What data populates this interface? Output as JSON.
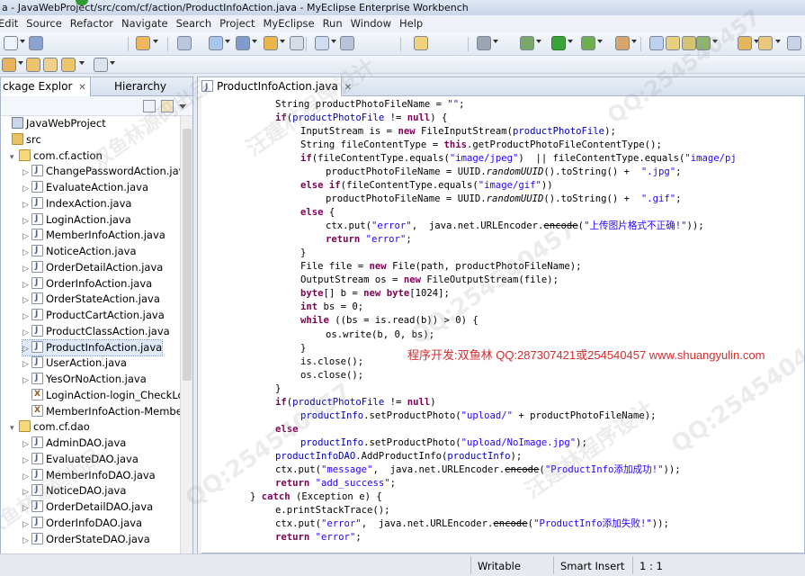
{
  "window": {
    "title": "a - JavaWebProject/src/com/cf/action/ProductInfoAction.java - MyEclipse Enterprise Workbench"
  },
  "menu": [
    "Edit",
    "Source",
    "Refactor",
    "Navigate",
    "Search",
    "Project",
    "MyEclipse",
    "Run",
    "Window",
    "Help"
  ],
  "left_panel": {
    "tabs": [
      {
        "label": "ckage Explor",
        "close": "✕"
      },
      {
        "label": "Hierarchy"
      }
    ],
    "tree": [
      {
        "label": "JavaWebProject",
        "type": "project",
        "level": 0,
        "toggle": "",
        "selected": false
      },
      {
        "label": "src",
        "type": "src",
        "level": 0,
        "toggle": "",
        "selected": false
      },
      {
        "label": "com.cf.action",
        "type": "package",
        "level": 1,
        "toggle": "▾",
        "selected": false
      },
      {
        "label": "ChangePasswordAction.java",
        "type": "java",
        "level": 2,
        "toggle": "▷",
        "selected": false
      },
      {
        "label": "EvaluateAction.java",
        "type": "java",
        "level": 2,
        "toggle": "▷",
        "selected": false
      },
      {
        "label": "IndexAction.java",
        "type": "java",
        "level": 2,
        "toggle": "▷",
        "selected": false
      },
      {
        "label": "LoginAction.java",
        "type": "java",
        "level": 2,
        "toggle": "▷",
        "selected": false
      },
      {
        "label": "MemberInfoAction.java",
        "type": "java",
        "level": 2,
        "toggle": "▷",
        "selected": false
      },
      {
        "label": "NoticeAction.java",
        "type": "java",
        "level": 2,
        "toggle": "▷",
        "selected": false
      },
      {
        "label": "OrderDetailAction.java",
        "type": "java",
        "level": 2,
        "toggle": "▷",
        "selected": false
      },
      {
        "label": "OrderInfoAction.java",
        "type": "java",
        "level": 2,
        "toggle": "▷",
        "selected": false
      },
      {
        "label": "OrderStateAction.java",
        "type": "java",
        "level": 2,
        "toggle": "▷",
        "selected": false
      },
      {
        "label": "ProductCartAction.java",
        "type": "java",
        "level": 2,
        "toggle": "▷",
        "selected": false
      },
      {
        "label": "ProductClassAction.java",
        "type": "java",
        "level": 2,
        "toggle": "▷",
        "selected": false
      },
      {
        "label": "ProductInfoAction.java",
        "type": "java",
        "level": 2,
        "toggle": "▷",
        "selected": true
      },
      {
        "label": "UserAction.java",
        "type": "java",
        "level": 2,
        "toggle": "▷",
        "selected": false
      },
      {
        "label": "YesOrNoAction.java",
        "type": "java",
        "level": 2,
        "toggle": "▷",
        "selected": false
      },
      {
        "label": "LoginAction-login_CheckLog",
        "type": "xml",
        "level": 2,
        "toggle": "",
        "selected": false
      },
      {
        "label": "MemberInfoAction-Member",
        "type": "xml",
        "level": 2,
        "toggle": "",
        "selected": false
      },
      {
        "label": "com.cf.dao",
        "type": "package",
        "level": 1,
        "toggle": "▾",
        "selected": false
      },
      {
        "label": "AdminDAO.java",
        "type": "java",
        "level": 2,
        "toggle": "▷",
        "selected": false
      },
      {
        "label": "EvaluateDAO.java",
        "type": "java",
        "level": 2,
        "toggle": "▷",
        "selected": false
      },
      {
        "label": "MemberInfoDAO.java",
        "type": "java",
        "level": 2,
        "toggle": "▷",
        "selected": false
      },
      {
        "label": "NoticeDAO.java",
        "type": "java",
        "level": 2,
        "toggle": "▷",
        "selected": false
      },
      {
        "label": "OrderDetailDAO.java",
        "type": "java",
        "level": 2,
        "toggle": "▷",
        "selected": false
      },
      {
        "label": "OrderInfoDAO.java",
        "type": "java",
        "level": 2,
        "toggle": "▷",
        "selected": false
      },
      {
        "label": "OrderStateDAO.java",
        "type": "java",
        "level": 2,
        "toggle": "▷",
        "selected": false
      }
    ]
  },
  "editor": {
    "tab_label": "ProductInfoAction.java",
    "tab_close": "✕",
    "lines": [
      {
        "indent": 3,
        "tokens": [
          [
            "",
            "String productPhotoFileName = "
          ],
          [
            "str",
            "\"\""
          ],
          [
            "",
            ";"
          ]
        ]
      },
      {
        "indent": 3,
        "tokens": [
          [
            "kw",
            "if"
          ],
          [
            "",
            "("
          ],
          [
            "fld",
            "productPhotoFile"
          ],
          [
            "",
            " != "
          ],
          [
            "kw",
            "null"
          ],
          [
            "",
            ") {"
          ]
        ]
      },
      {
        "indent": 4,
        "tokens": [
          [
            "",
            "InputStream is = "
          ],
          [
            "kw",
            "new"
          ],
          [
            "",
            " FileInputStream("
          ],
          [
            "fld",
            "productPhotoFile"
          ],
          [
            "",
            ");"
          ]
        ]
      },
      {
        "indent": 4,
        "tokens": [
          [
            "",
            "String fileContentType = "
          ],
          [
            "kw",
            "this"
          ],
          [
            "",
            ".getProductPhotoFileContentType();"
          ]
        ]
      },
      {
        "indent": 4,
        "tokens": [
          [
            "kw",
            "if"
          ],
          [
            "",
            "(fileContentType.equals("
          ],
          [
            "str",
            "\"image/jpeg\""
          ],
          [
            "",
            ")  || fileContentType.equals("
          ],
          [
            "str",
            "\"image/pj"
          ]
        ]
      },
      {
        "indent": 5,
        "tokens": [
          [
            "",
            "productPhotoFileName = UUID."
          ],
          [
            "ital",
            "randomUUID"
          ],
          [
            "",
            "().toString() +  "
          ],
          [
            "str",
            "\".jpg\""
          ],
          [
            "",
            ";"
          ]
        ]
      },
      {
        "indent": 4,
        "tokens": [
          [
            "kw",
            "else if"
          ],
          [
            "",
            "(fileContentType.equals("
          ],
          [
            "str",
            "\"image/gif\""
          ],
          [
            "",
            "))"
          ]
        ]
      },
      {
        "indent": 5,
        "tokens": [
          [
            "",
            "productPhotoFileName = UUID."
          ],
          [
            "ital",
            "randomUUID"
          ],
          [
            "",
            "().toString() +  "
          ],
          [
            "str",
            "\".gif\""
          ],
          [
            "",
            ";"
          ]
        ]
      },
      {
        "indent": 4,
        "tokens": [
          [
            "kw",
            "else"
          ],
          [
            "",
            " {"
          ]
        ]
      },
      {
        "indent": 5,
        "tokens": [
          [
            "",
            "ctx.put("
          ],
          [
            "str",
            "\"error\""
          ],
          [
            "",
            ",  java.net.URLEncoder."
          ],
          [
            "strike",
            "encode"
          ],
          [
            "",
            "("
          ],
          [
            "str",
            "\"上传图片格式不正确!\""
          ],
          [
            "",
            "));"
          ]
        ]
      },
      {
        "indent": 5,
        "tokens": [
          [
            "kw",
            "return"
          ],
          [
            "",
            " "
          ],
          [
            "str",
            "\"error\""
          ],
          [
            "",
            ";"
          ]
        ]
      },
      {
        "indent": 4,
        "tokens": [
          [
            "",
            "}"
          ]
        ]
      },
      {
        "indent": 4,
        "tokens": [
          [
            "",
            "File file = "
          ],
          [
            "kw",
            "new"
          ],
          [
            "",
            " File(path, productPhotoFileName);"
          ]
        ]
      },
      {
        "indent": 4,
        "tokens": [
          [
            "",
            "OutputStream os = "
          ],
          [
            "kw",
            "new"
          ],
          [
            "",
            " FileOutputStream(file);"
          ]
        ]
      },
      {
        "indent": 4,
        "tokens": [
          [
            "kw",
            "byte"
          ],
          [
            "",
            "[] b = "
          ],
          [
            "kw",
            "new"
          ],
          [
            "",
            " "
          ],
          [
            "kw",
            "byte"
          ],
          [
            "",
            "[1024];"
          ]
        ]
      },
      {
        "indent": 4,
        "tokens": [
          [
            "kw",
            "int"
          ],
          [
            "",
            " bs = 0;"
          ]
        ]
      },
      {
        "indent": 4,
        "tokens": [
          [
            "kw",
            "while"
          ],
          [
            "",
            " ((bs = is.read(b)) > 0) {"
          ]
        ]
      },
      {
        "indent": 5,
        "tokens": [
          [
            "",
            "os.write(b, 0, bs);"
          ]
        ]
      },
      {
        "indent": 4,
        "tokens": [
          [
            "",
            "}"
          ]
        ]
      },
      {
        "indent": 4,
        "tokens": [
          [
            "",
            "is.close();"
          ]
        ]
      },
      {
        "indent": 4,
        "tokens": [
          [
            "",
            "os.close();"
          ]
        ]
      },
      {
        "indent": 3,
        "tokens": [
          [
            "",
            "}"
          ]
        ]
      },
      {
        "indent": 3,
        "tokens": [
          [
            "kw",
            "if"
          ],
          [
            "",
            "("
          ],
          [
            "fld",
            "productPhotoFile"
          ],
          [
            "",
            " != "
          ],
          [
            "kw",
            "null"
          ],
          [
            "",
            ")"
          ]
        ]
      },
      {
        "indent": 4,
        "tokens": [
          [
            "fld",
            "productInfo"
          ],
          [
            "",
            ".setProductPhoto("
          ],
          [
            "str",
            "\"upload/\""
          ],
          [
            "",
            " + productPhotoFileName);"
          ]
        ]
      },
      {
        "indent": 3,
        "tokens": [
          [
            "kw",
            "else"
          ]
        ]
      },
      {
        "indent": 4,
        "tokens": [
          [
            "fld",
            "productInfo"
          ],
          [
            "",
            ".setProductPhoto("
          ],
          [
            "str",
            "\"upload/NoImage.jpg\""
          ],
          [
            "",
            ");"
          ]
        ]
      },
      {
        "indent": 3,
        "tokens": [
          [
            "fld",
            "productInfoDAO"
          ],
          [
            "",
            ".AddProductInfo("
          ],
          [
            "fld",
            "productInfo"
          ],
          [
            "",
            ");"
          ]
        ]
      },
      {
        "indent": 3,
        "tokens": [
          [
            "",
            "ctx.put("
          ],
          [
            "str",
            "\"message\""
          ],
          [
            "",
            ",  java.net.URLEncoder."
          ],
          [
            "strike",
            "encode"
          ],
          [
            "",
            "("
          ],
          [
            "str",
            "\"ProductInfo添加成功!\""
          ],
          [
            "",
            "));"
          ]
        ]
      },
      {
        "indent": 3,
        "tokens": [
          [
            "kw",
            "return"
          ],
          [
            "",
            " "
          ],
          [
            "str",
            "\"add_success\""
          ],
          [
            "",
            ";"
          ]
        ]
      },
      {
        "indent": 2,
        "tokens": [
          [
            "",
            "} "
          ],
          [
            "kw",
            "catch"
          ],
          [
            "",
            " (Exception e) {"
          ]
        ]
      },
      {
        "indent": 3,
        "tokens": [
          [
            "",
            "e.printStackTrace();"
          ]
        ]
      },
      {
        "indent": 3,
        "tokens": [
          [
            "",
            "ctx.put("
          ],
          [
            "str",
            "\"error\""
          ],
          [
            "",
            ",  java.net.URLEncoder."
          ],
          [
            "strike",
            "encode"
          ],
          [
            "",
            "("
          ],
          [
            "str",
            "\"ProductInfo添加失败!\""
          ],
          [
            "",
            "));"
          ]
        ]
      },
      {
        "indent": 3,
        "tokens": [
          [
            "kw",
            "return"
          ],
          [
            "",
            " "
          ],
          [
            "str",
            "\"error\""
          ],
          [
            "",
            ";"
          ]
        ]
      }
    ],
    "credit": "程序开发:双鱼林 QQ:287307421或254540457 www.shuangyulin.com"
  },
  "status": {
    "writable": "Writable",
    "insert_mode": "Smart Insert",
    "position": "1 : 1"
  },
  "watermarks": [
    "QQ:254540457",
    "汪建林程序设计",
    "双鱼林源码出品",
    "QQ:254540457",
    "QQ:254540457",
    "汪建林程序设计",
    "QQ:254540457",
    "双鱼林源码出品"
  ],
  "colors": {
    "keyword": "#7f0055",
    "string": "#2a00ff",
    "field": "#0000c0",
    "credit": "#d62d2d"
  }
}
